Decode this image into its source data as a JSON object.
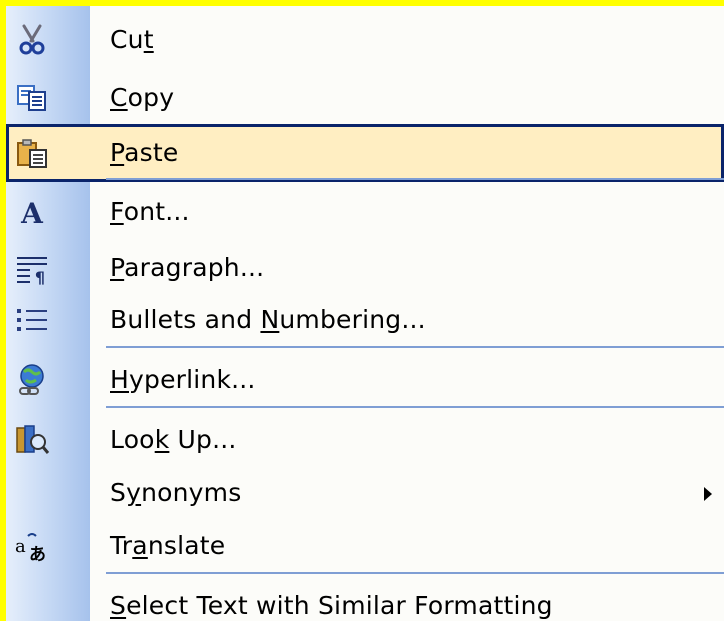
{
  "menu": {
    "items": [
      {
        "id": "cut",
        "before": "Cu",
        "mnemonic": "t",
        "after": "",
        "icon": "scissors-icon",
        "highlighted": false,
        "submenu": false
      },
      {
        "id": "copy",
        "before": "",
        "mnemonic": "C",
        "after": "opy",
        "icon": "copy-icon",
        "highlighted": false,
        "submenu": false
      },
      {
        "id": "paste",
        "before": "",
        "mnemonic": "P",
        "after": "aste",
        "icon": "paste-icon",
        "highlighted": true,
        "submenu": false
      },
      {
        "id": "font",
        "before": "",
        "mnemonic": "F",
        "after": "ont...",
        "icon": "font-icon",
        "highlighted": false,
        "submenu": false
      },
      {
        "id": "paragraph",
        "before": "",
        "mnemonic": "P",
        "after": "aragraph...",
        "icon": "paragraph-icon",
        "highlighted": false,
        "submenu": false
      },
      {
        "id": "bullets",
        "before": "Bullets and ",
        "mnemonic": "N",
        "after": "umbering...",
        "icon": "bullets-icon",
        "highlighted": false,
        "submenu": false
      },
      {
        "id": "hyperlink",
        "before": "",
        "mnemonic": "H",
        "after": "yperlink...",
        "icon": "hyperlink-icon",
        "highlighted": false,
        "submenu": false
      },
      {
        "id": "lookup",
        "before": "Loo",
        "mnemonic": "k",
        "after": " Up...",
        "icon": "lookup-icon",
        "highlighted": false,
        "submenu": false
      },
      {
        "id": "synonyms",
        "before": "S",
        "mnemonic": "y",
        "after": "nonyms",
        "icon": "",
        "highlighted": false,
        "submenu": true
      },
      {
        "id": "translate",
        "before": "Tr",
        "mnemonic": "a",
        "after": "nslate",
        "icon": "translate-icon",
        "highlighted": false,
        "submenu": false
      },
      {
        "id": "select-similar",
        "before": "",
        "mnemonic": "S",
        "after": "elect Text with Similar Formatting",
        "icon": "",
        "highlighted": false,
        "submenu": false
      }
    ],
    "colors": {
      "background": "#ffff00",
      "menu_face": "#fcfcf9",
      "highlight_fill": "#ffeec2",
      "highlight_border": "#0a246a",
      "separator": "#7f9ed4"
    }
  }
}
